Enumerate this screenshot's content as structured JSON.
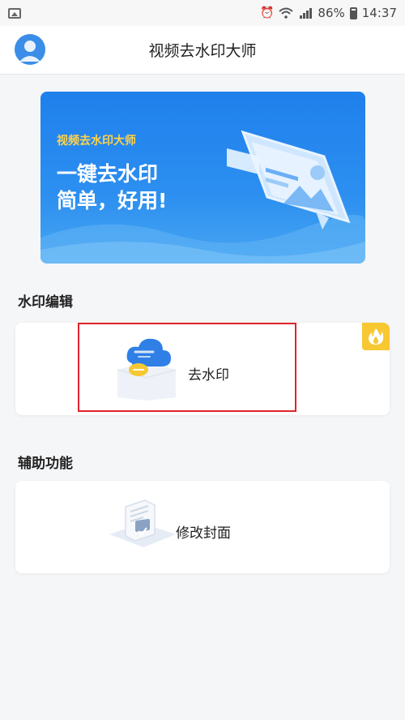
{
  "status_bar": {
    "battery": "86%",
    "time": "14:37",
    "icons": [
      "image-icon",
      "alarm-icon",
      "wifi-icon",
      "4g-signal-icon",
      "battery-icon"
    ]
  },
  "header": {
    "title": "视频去水印大师",
    "avatar_icon": "user-avatar-icon"
  },
  "banner": {
    "subtitle": "视频去水印大师",
    "headline_1": "一键去水印",
    "headline_2": "简单，好用!"
  },
  "sections": {
    "watermark_edit": {
      "title": "水印编辑",
      "card_label": "去水印",
      "badge_icon": "fire-icon"
    },
    "aux_functions": {
      "title": "辅助功能",
      "card_label": "修改封面"
    }
  },
  "colors": {
    "accent": "#2c8ff0",
    "badge": "#f7c832",
    "highlight": "#e0242e",
    "banner_subtitle": "#ffd34a"
  }
}
